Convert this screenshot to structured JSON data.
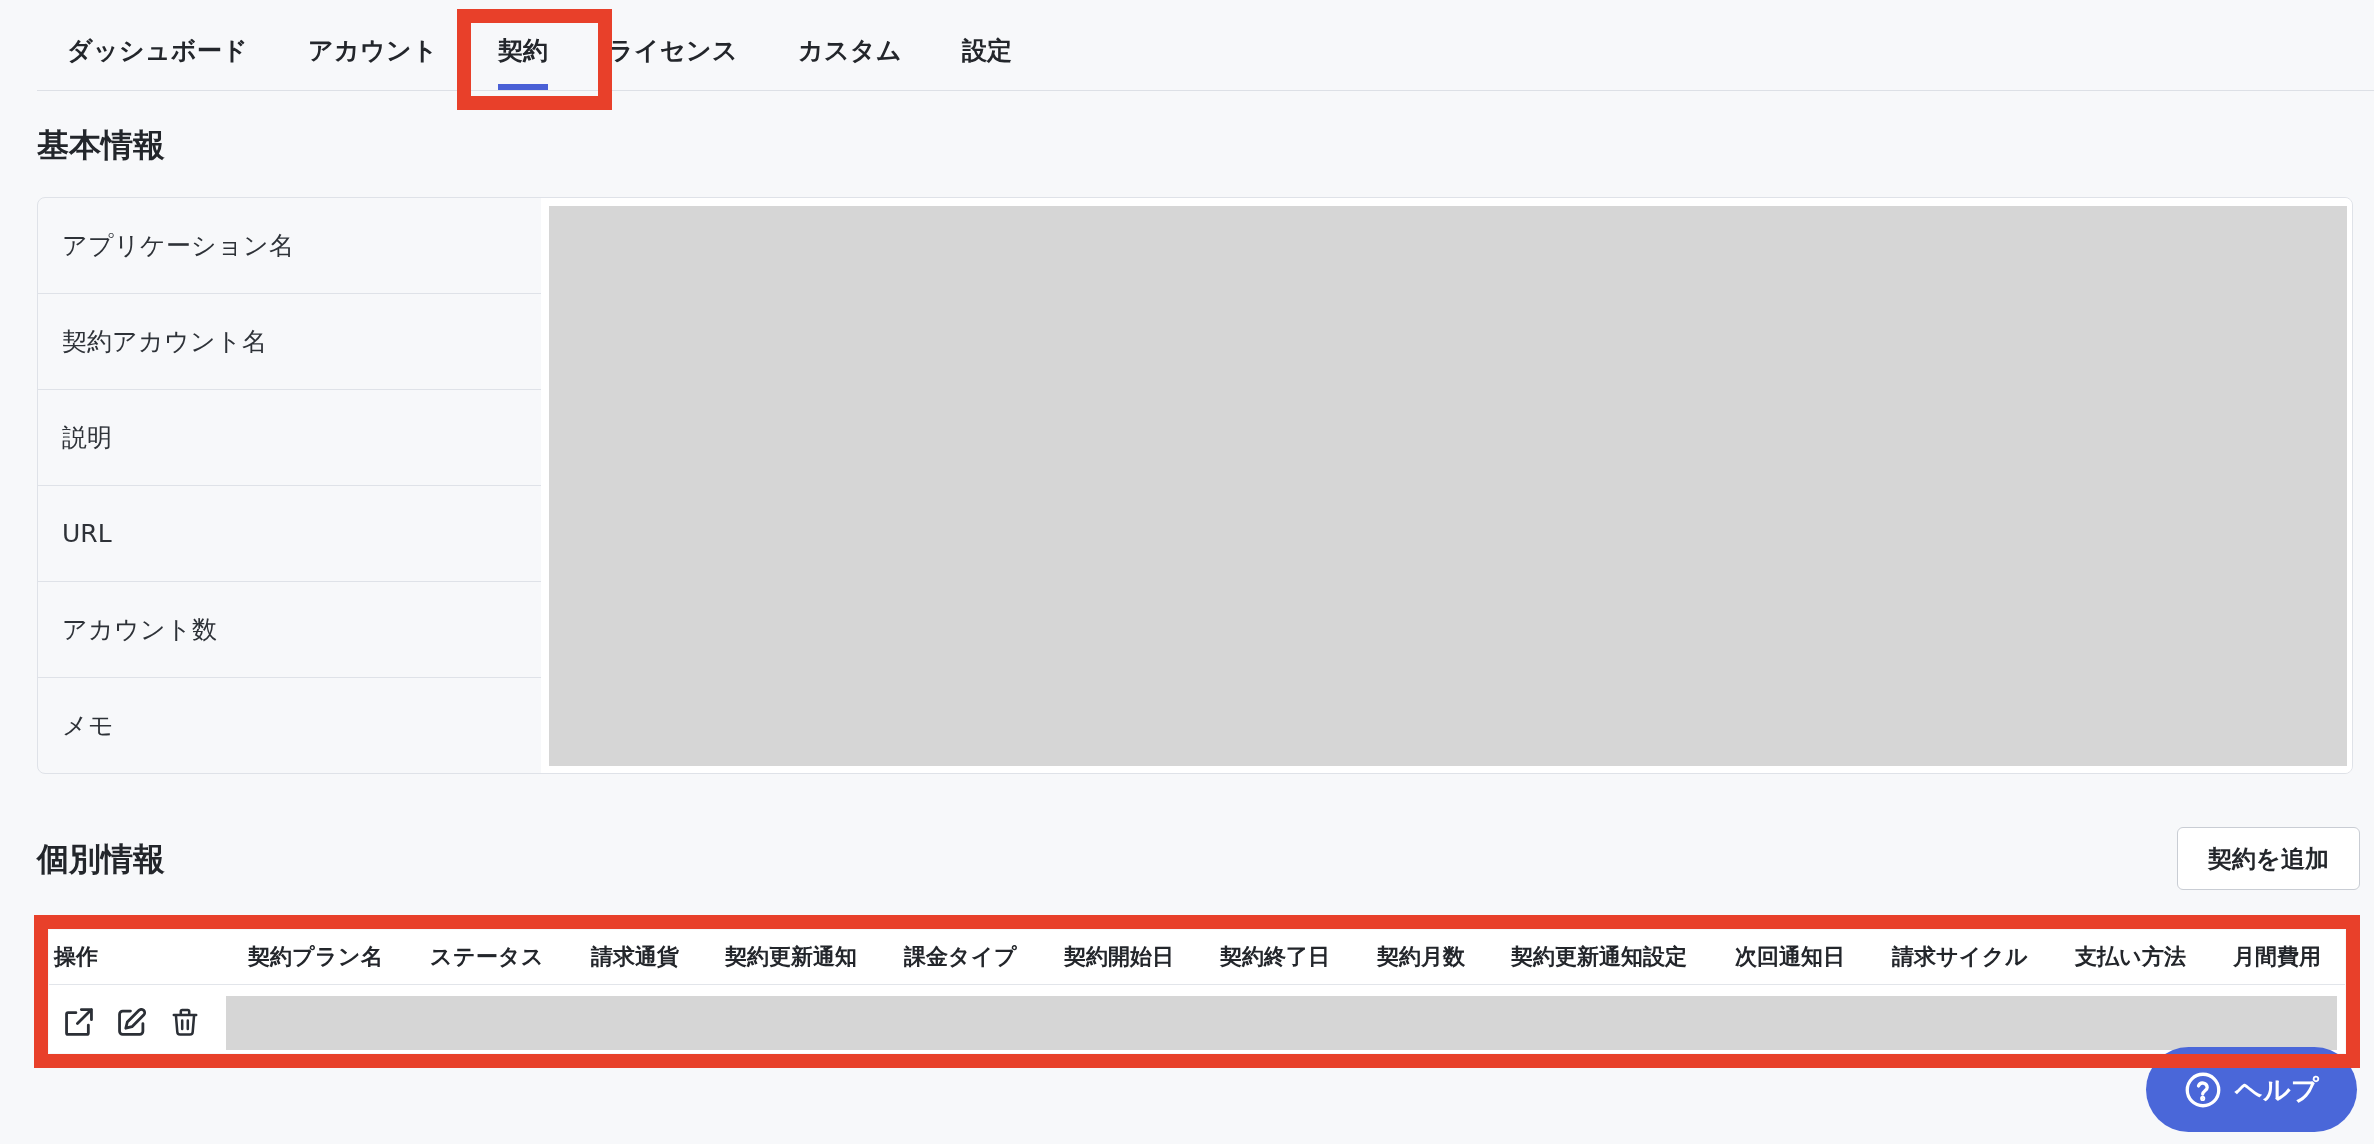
{
  "tabs": [
    {
      "label": "ダッシュボード",
      "selected": false,
      "highlighted": false
    },
    {
      "label": "アカウント",
      "selected": false,
      "highlighted": false
    },
    {
      "label": "契約",
      "selected": true,
      "highlighted": true
    },
    {
      "label": "ライセンス",
      "selected": false,
      "highlighted": false
    },
    {
      "label": "カスタム",
      "selected": false,
      "highlighted": false
    },
    {
      "label": "設定",
      "selected": false,
      "highlighted": false
    }
  ],
  "basic_info": {
    "title": "基本情報",
    "values_redacted": true,
    "rows": [
      {
        "label": "アプリケーション名"
      },
      {
        "label": "契約アカウント名"
      },
      {
        "label": "説明"
      },
      {
        "label": "URL"
      },
      {
        "label": "アカウント数"
      },
      {
        "label": "メモ"
      }
    ]
  },
  "individual_info": {
    "title": "個別情報",
    "add_button": "契約を追加",
    "table": {
      "highlighted": true,
      "columns": [
        "操作",
        "契約プラン名",
        "ステータス",
        "請求通貨",
        "契約更新通知",
        "課金タイプ",
        "契約開始日",
        "契約終了日",
        "契約月数",
        "契約更新通知設定",
        "次回通知日",
        "請求サイクル",
        "支払い方法",
        "月間費用"
      ],
      "rows": [
        {
          "redacted": true
        }
      ]
    }
  },
  "help_button": {
    "label": "ヘルプ"
  }
}
